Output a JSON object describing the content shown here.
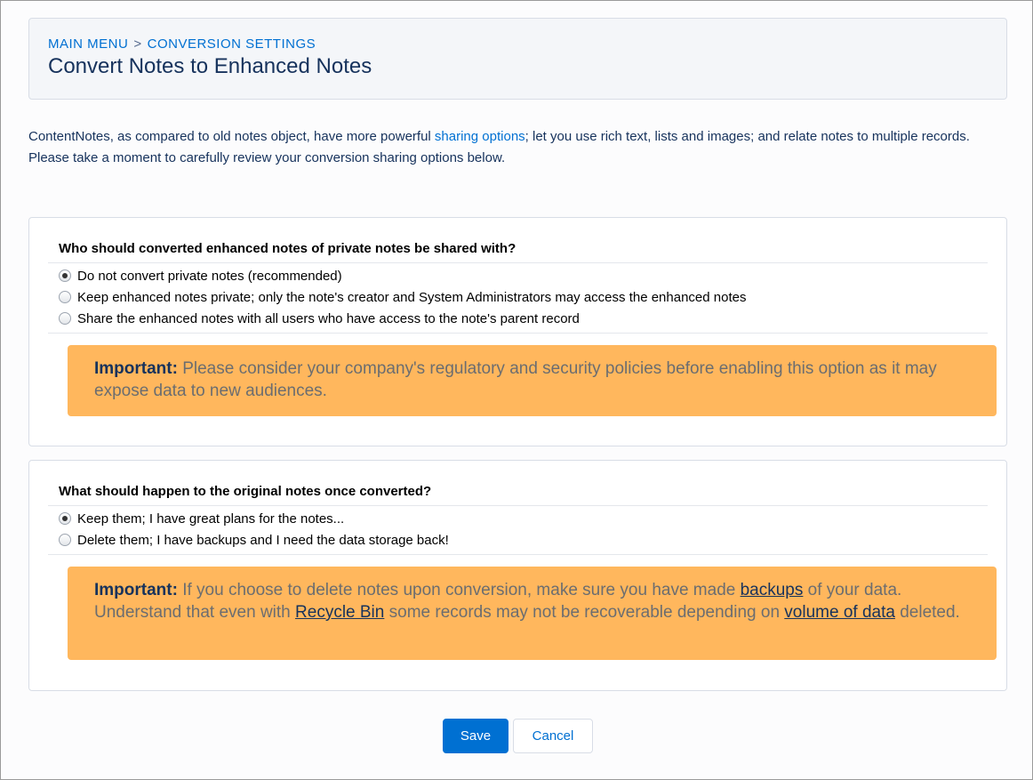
{
  "breadcrumb": {
    "items": [
      "MAIN MENU",
      "CONVERSION SETTINGS"
    ],
    "separator": ">"
  },
  "page": {
    "title": "Convert Notes to Enhanced Notes"
  },
  "intro": {
    "line1_before": "ContentNotes, as compared to old notes object, have more powerful ",
    "link": "sharing options",
    "line1_after": "; let you use rich text, lists and images; and relate notes to multiple records.",
    "line2": "Please take a moment to carefully review your conversion sharing options below."
  },
  "sections": [
    {
      "question": "Who should converted enhanced notes of private notes be shared with?",
      "options": [
        {
          "label": "Do not convert private notes (recommended)",
          "checked": true
        },
        {
          "label": "Keep enhanced notes private; only the note's creator and System Administrators may access the enhanced notes",
          "checked": false
        },
        {
          "label": "Share the enhanced notes with all users who have access to the note's parent record",
          "checked": false
        }
      ],
      "warning": {
        "label": "Important:",
        "text": " Please consider your company's regulatory and security policies before enabling this option as it may expose data to new audiences."
      }
    },
    {
      "question": "What should happen to the original notes once converted?",
      "options": [
        {
          "label": "Keep them; I have great plans for the notes...",
          "checked": true
        },
        {
          "label": "Delete them; I have backups and I need the data storage back!",
          "checked": false
        }
      ],
      "warning": {
        "label": "Important:",
        "t1": " If you choose to delete notes upon conversion, make sure you have made ",
        "l1": "backups",
        "t2": " of your data. Understand that even with ",
        "l2": "Recycle Bin",
        "t3": " some records may not be recoverable depending on ",
        "l3": "volume of data",
        "t4": " deleted."
      }
    }
  ],
  "buttons": {
    "save": "Save",
    "cancel": "Cancel"
  },
  "colors": {
    "accent": "#0070d2",
    "warning": "#ffb75d",
    "text": "#16325c"
  }
}
